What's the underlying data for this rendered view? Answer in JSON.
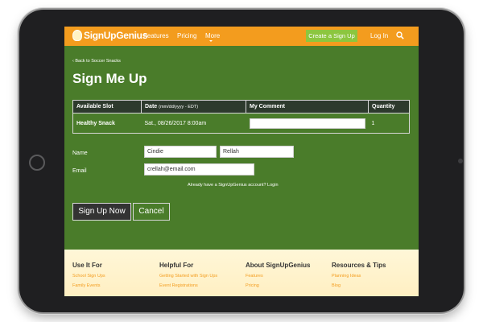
{
  "nav": {
    "logo": "SignUpGenius",
    "links": [
      "Features",
      "Pricing",
      "More"
    ],
    "create_label": "Create a Sign Up",
    "login_label": "Log In"
  },
  "page": {
    "back_link": "Back to Soccer Snacks",
    "title": "Sign Me Up"
  },
  "table": {
    "headers": {
      "slot": "Available Slot",
      "date": "Date",
      "date_format": "(mm/dd/yyyy - EDT)",
      "comment": "My Comment",
      "quantity": "Quantity"
    },
    "rows": [
      {
        "slot": "Healthy Snack",
        "date": "Sat., 08/26/2017 8:00am",
        "comment": "",
        "quantity": "1"
      }
    ]
  },
  "form": {
    "name_label": "Name",
    "first_name": "Cindie",
    "last_name": "Rellah",
    "email_label": "Email",
    "email": "crellah@email.com",
    "login_prompt": "Already have a SignUpGenius account? Login"
  },
  "buttons": {
    "signup": "Sign Up Now",
    "cancel": "Cancel"
  },
  "footer": {
    "columns": [
      {
        "heading": "Use It For",
        "links": [
          "School Sign Ups",
          "Family Events"
        ]
      },
      {
        "heading": "Helpful For",
        "links": [
          "Getting Started with Sign Ups",
          "Event Registrations"
        ]
      },
      {
        "heading": "About SignUpGenius",
        "links": [
          "Features",
          "Pricing"
        ]
      },
      {
        "heading": "Resources & Tips",
        "links": [
          "Planning Ideas",
          "Blog"
        ]
      }
    ]
  },
  "colors": {
    "brand_orange": "#f39c1e",
    "page_green": "#4a7c2a",
    "button_green": "#8cc63f"
  },
  "icons": [
    "lightbulb-icon",
    "search-icon",
    "chevron-left-icon",
    "chevron-down-icon"
  ]
}
